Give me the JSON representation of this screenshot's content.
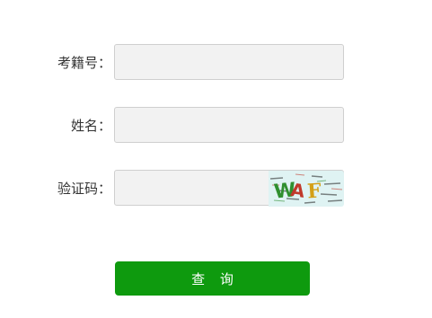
{
  "form": {
    "fields": [
      {
        "label": "考籍号：",
        "value": "",
        "placeholder": ""
      },
      {
        "label": "姓名：",
        "value": "",
        "placeholder": ""
      },
      {
        "label": "验证码：",
        "value": "",
        "placeholder": ""
      }
    ],
    "captcha": {
      "text": "WAF",
      "colors": [
        "#2f8f2f",
        "#c0392b",
        "#d4a017"
      ],
      "background": "#dff3f3"
    },
    "submit_label": "查 询",
    "submit_color": "#0e9a0e"
  }
}
